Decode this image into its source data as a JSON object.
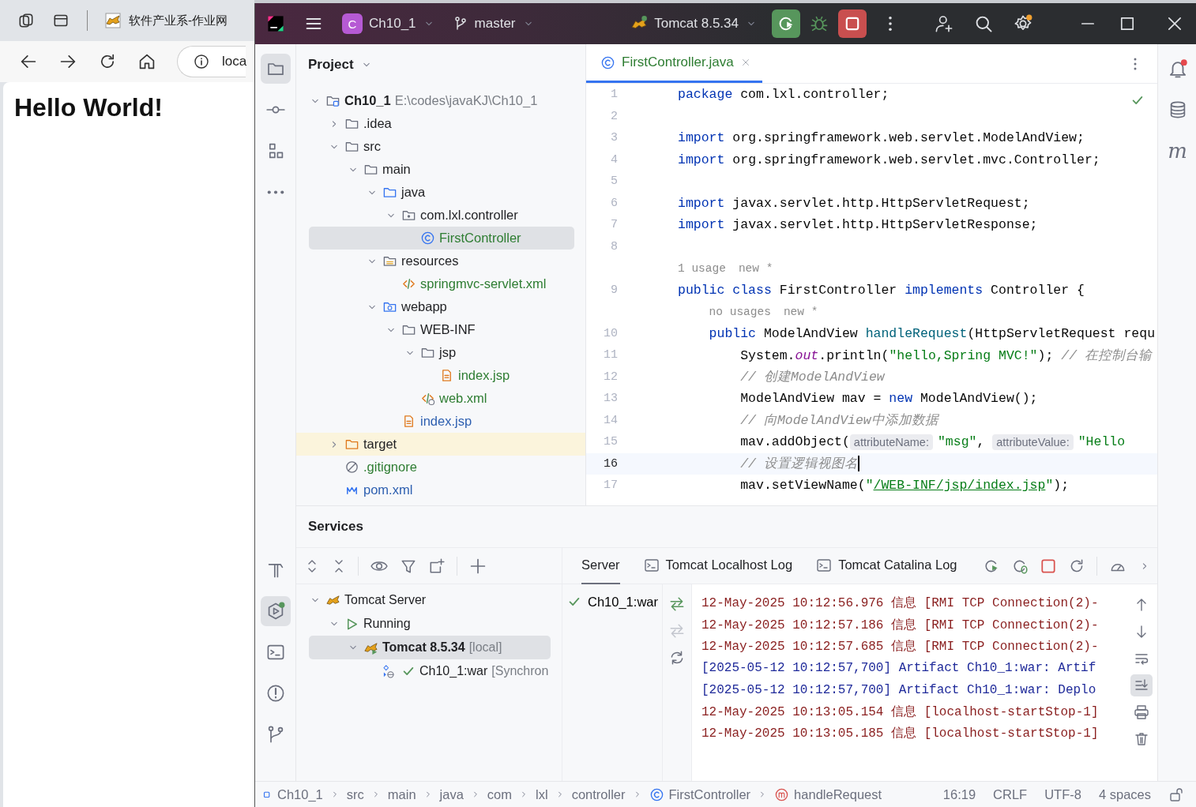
{
  "browser": {
    "tab_title": "软件产业系-作业网",
    "address": "loca",
    "heading": "Hello World!"
  },
  "ide": {
    "project_initial": "C",
    "project": "Ch10_1",
    "branch": "master",
    "run_config": "Tomcat 8.5.34",
    "settings_badge": true,
    "left_tools": [
      {
        "kind": "project",
        "selected": true
      },
      {
        "kind": "commit",
        "selected": false
      },
      {
        "kind": "structure",
        "selected": false
      },
      {
        "kind": "more",
        "selected": false
      }
    ],
    "left_tools_bottom": [
      {
        "kind": "build",
        "selected": false
      },
      {
        "kind": "services",
        "selected": true
      },
      {
        "kind": "terminal",
        "selected": false
      },
      {
        "kind": "problems",
        "selected": false
      },
      {
        "kind": "git",
        "selected": false
      }
    ],
    "right_tools": [
      {
        "kind": "notifications"
      },
      {
        "kind": "database"
      },
      {
        "kind": "maven",
        "glyph": "m"
      }
    ],
    "project_panel": {
      "title": "Project",
      "tree": [
        {
          "label": "Ch10_1",
          "detail": "E:\\codes\\javaKJ\\Ch10_1",
          "kind": "module",
          "expanded": true,
          "selected": false,
          "children": [
            {
              "label": ".idea",
              "kind": "folder",
              "expanded": false,
              "selected": false
            },
            {
              "label": "src",
              "kind": "folder",
              "expanded": true,
              "selected": false,
              "children": [
                {
                  "label": "main",
                  "kind": "folder",
                  "expanded": true,
                  "selected": false,
                  "children": [
                    {
                      "label": "java",
                      "kind": "source-folder",
                      "expanded": true,
                      "selected": false,
                      "children": [
                        {
                          "label": "com.lxl.controller",
                          "kind": "package",
                          "expanded": true,
                          "selected": false,
                          "children": [
                            {
                              "label": "FirstController",
                              "kind": "class",
                              "color": "#2e7d32",
                              "selected": true
                            }
                          ]
                        }
                      ]
                    },
                    {
                      "label": "resources",
                      "kind": "resource-folder",
                      "expanded": true,
                      "selected": false,
                      "children": [
                        {
                          "label": "springmvc-servlet.xml",
                          "kind": "xml",
                          "color": "#2e7d32",
                          "selected": false
                        }
                      ]
                    },
                    {
                      "label": "webapp",
                      "kind": "web-folder",
                      "expanded": true,
                      "selected": false,
                      "children": [
                        {
                          "label": "WEB-INF",
                          "kind": "folder",
                          "expanded": true,
                          "selected": false,
                          "children": [
                            {
                              "label": "jsp",
                              "kind": "folder",
                              "expanded": true,
                              "selected": false,
                              "children": [
                                {
                                  "label": "index.jsp",
                                  "kind": "jsp",
                                  "color": "#2e7d32",
                                  "selected": false
                                }
                              ]
                            },
                            {
                              "label": "web.xml",
                              "kind": "web-xml",
                              "color": "#2e7d32",
                              "selected": false
                            }
                          ]
                        },
                        {
                          "label": "index.jsp",
                          "kind": "jsp",
                          "color": "#2d5fb0",
                          "selected": false
                        }
                      ]
                    }
                  ]
                }
              ]
            },
            {
              "label": "target",
              "kind": "excluded-folder",
              "expanded": false,
              "selected": false
            },
            {
              "label": ".gitignore",
              "kind": "ignore-file",
              "color": "#2e7d32",
              "selected": false
            },
            {
              "label": "pom.xml",
              "kind": "maven-file",
              "color": "#2d5fb0",
              "selected": false
            }
          ]
        }
      ]
    },
    "editor": {
      "tabs": [
        {
          "label": "FirstController.java",
          "color": "#2e7d32",
          "selected": true
        }
      ],
      "lines": [
        {
          "number": "1",
          "current": false,
          "segments": [
            {
              "kind": "keyword",
              "text": "package"
            },
            {
              "kind": "plain",
              "text": " com.lxl.controller;"
            }
          ]
        },
        {
          "number": "2",
          "current": false
        },
        {
          "number": "3",
          "current": false,
          "segments": [
            {
              "kind": "keyword",
              "text": "import"
            },
            {
              "kind": "plain",
              "text": " org.springframework.web.servlet.ModelAndView;"
            }
          ]
        },
        {
          "number": "4",
          "current": false,
          "segments": [
            {
              "kind": "keyword",
              "text": "import"
            },
            {
              "kind": "plain",
              "text": " org.springframework.web.servlet.mvc.Controller;"
            }
          ]
        },
        {
          "number": "5",
          "current": false
        },
        {
          "number": "6",
          "current": false,
          "segments": [
            {
              "kind": "keyword",
              "text": "import"
            },
            {
              "kind": "plain",
              "text": " javax.servlet.http.HttpServletRequest;"
            }
          ]
        },
        {
          "number": "7",
          "current": false,
          "segments": [
            {
              "kind": "keyword",
              "text": "import"
            },
            {
              "kind": "plain",
              "text": " javax.servlet.http.HttpServletResponse;"
            }
          ]
        },
        {
          "number": "8",
          "current": false
        },
        {
          "hints": [
            "1 usage",
            "new *"
          ]
        },
        {
          "number": "9",
          "current": false,
          "segments": [
            {
              "kind": "keyword",
              "text": "public class"
            },
            {
              "kind": "plain",
              "text": " FirstController "
            },
            {
              "kind": "keyword",
              "text": "implements"
            },
            {
              "kind": "plain",
              "text": " Controller {"
            }
          ]
        },
        {
          "hints": [
            "no usages",
            "new *"
          ]
        },
        {
          "number": "10",
          "current": false,
          "segments": [
            {
              "kind": "keyword",
              "text": "    public"
            },
            {
              "kind": "plain",
              "text": " ModelAndView "
            },
            {
              "kind": "method",
              "text": "handleRequest"
            },
            {
              "kind": "plain",
              "text": "(HttpServletRequest requ"
            }
          ]
        },
        {
          "number": "11",
          "current": false,
          "segments": [
            {
              "kind": "plain",
              "text": "        System."
            },
            {
              "kind": "field",
              "text": "out"
            },
            {
              "kind": "plain",
              "text": ".println("
            },
            {
              "kind": "string",
              "text": "\"hello,Spring MVC!\""
            },
            {
              "kind": "plain",
              "text": "); "
            },
            {
              "kind": "comment",
              "text": "// 在控制台输"
            }
          ]
        },
        {
          "number": "12",
          "current": false,
          "segments": [
            {
              "kind": "comment",
              "text": "        // 创建ModelAndView"
            }
          ]
        },
        {
          "number": "13",
          "current": false,
          "segments": [
            {
              "kind": "plain",
              "text": "        ModelAndView mav = "
            },
            {
              "kind": "keyword",
              "text": "new"
            },
            {
              "kind": "plain",
              "text": " ModelAndView();"
            }
          ]
        },
        {
          "number": "14",
          "current": false,
          "segments": [
            {
              "kind": "comment",
              "text": "        // 向ModelAndView中添加数据"
            }
          ]
        },
        {
          "number": "15",
          "current": false,
          "segments": [
            {
              "kind": "plain",
              "text": "        mav.addObject("
            },
            {
              "kind": "hint",
              "text": "attributeName:"
            },
            {
              "kind": "string",
              "text": "\"msg\""
            },
            {
              "kind": "plain",
              "text": ", "
            },
            {
              "kind": "hint",
              "text": "attributeValue:"
            },
            {
              "kind": "string",
              "text": "\"Hello"
            }
          ]
        },
        {
          "number": "16",
          "current": true,
          "segments": [
            {
              "kind": "comment",
              "text": "        // 设置逻辑视图名"
            }
          ]
        },
        {
          "number": "17",
          "current": false,
          "segments": [
            {
              "kind": "plain",
              "text": "        mav.setViewName("
            },
            {
              "kind": "string",
              "text": "\""
            },
            {
              "kind": "link",
              "text": "/WEB-INF/jsp/index.jsp"
            },
            {
              "kind": "string",
              "text": "\""
            },
            {
              "kind": "plain",
              "text": ");"
            }
          ]
        }
      ]
    },
    "services": {
      "title": "Services",
      "tree": [
        {
          "label": "Tomcat Server",
          "kind": "server-group",
          "expanded": true,
          "selected": false,
          "children": [
            {
              "label": "Running",
              "kind": "status",
              "expanded": true,
              "selected": false,
              "children": [
                {
                  "label": "Tomcat 8.5.34",
                  "detail": "[local]",
                  "kind": "server",
                  "expanded": true,
                  "selected": true,
                  "children": [
                    {
                      "label": "Ch10_1:war",
                      "detail": "[Synchron",
                      "kind": "artifact",
                      "selected": false
                    }
                  ]
                }
              ]
            }
          ]
        }
      ],
      "tabs": [
        {
          "label": "Server",
          "kind": "plain",
          "selected": true
        },
        {
          "label": "Tomcat Localhost Log",
          "kind": "log",
          "selected": false
        },
        {
          "label": "Tomcat Catalina Log",
          "kind": "log",
          "selected": false
        }
      ],
      "artifacts": [
        {
          "label": "Ch10_1:war",
          "deployed": true
        }
      ],
      "log": [
        {
          "kind": "info",
          "text": "12-May-2025 10:12:56.976 信息 [RMI TCP Connection(2)-"
        },
        {
          "kind": "info",
          "text": "12-May-2025 10:12:57.186 信息 [RMI TCP Connection(2)-"
        },
        {
          "kind": "info",
          "text": "12-May-2025 10:12:57.685 信息 [RMI TCP Connection(2)-"
        },
        {
          "kind": "system",
          "text": "[2025-05-12 10:12:57,700] Artifact Ch10_1:war: Artif"
        },
        {
          "kind": "system",
          "text": "[2025-05-12 10:12:57,700] Artifact Ch10_1:war: Deplo"
        },
        {
          "kind": "info",
          "text": "12-May-2025 10:13:05.154 信息 [localhost-startStop-1]"
        },
        {
          "kind": "info",
          "text": "12-May-2025 10:13:05.185 信息 [localhost-startStop-1]"
        }
      ],
      "console_tools": [
        {
          "kind": "up",
          "selected": false
        },
        {
          "kind": "down",
          "selected": false
        },
        {
          "kind": "wrap",
          "selected": false
        },
        {
          "kind": "scroll-end",
          "selected": true
        },
        {
          "kind": "print",
          "selected": false
        },
        {
          "kind": "clear",
          "selected": false
        }
      ]
    },
    "status_bar": {
      "breadcrumbs": [
        {
          "kind": "module",
          "label": "Ch10_1"
        },
        {
          "kind": "folder",
          "label": "src"
        },
        {
          "kind": "folder",
          "label": "main"
        },
        {
          "kind": "folder",
          "label": "java"
        },
        {
          "kind": "folder",
          "label": "com"
        },
        {
          "kind": "folder",
          "label": "lxl"
        },
        {
          "kind": "folder",
          "label": "controller"
        },
        {
          "kind": "class",
          "label": "FirstController"
        },
        {
          "kind": "method",
          "label": "handleRequest"
        }
      ],
      "items": [
        "16:19",
        "CRLF",
        "UTF-8",
        "4 spaces"
      ]
    }
  }
}
